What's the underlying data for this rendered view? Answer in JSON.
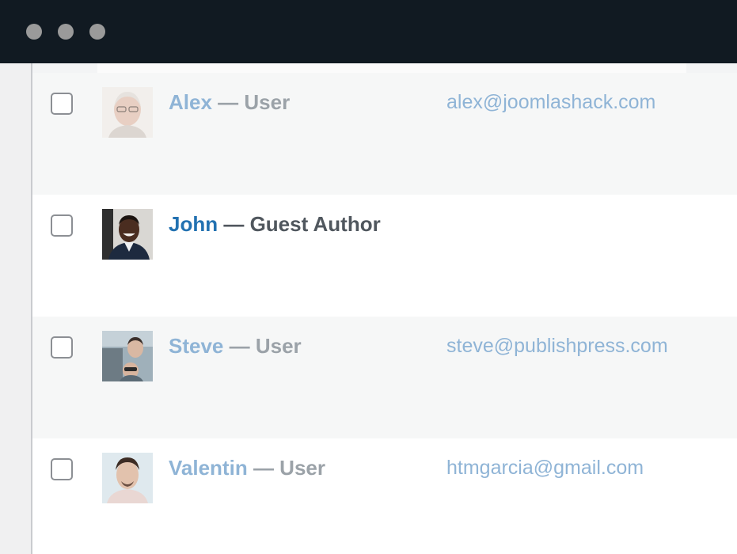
{
  "window": {
    "controls": [
      "close-dot",
      "minimize-dot",
      "maximize-dot"
    ]
  },
  "users": [
    {
      "name": "Alex",
      "role": "— User",
      "email": "alex@joomlashack.com",
      "avatar": "user-avatar-photo"
    },
    {
      "name": "John",
      "role": "— Guest Author",
      "email": "",
      "avatar": "user-avatar-photo"
    },
    {
      "name": "Steve",
      "role": "— User",
      "email": "steve@publishpress.com",
      "avatar": "user-avatar-photo"
    },
    {
      "name": "Valentin",
      "role": "— User",
      "email": "htmgarcia@gmail.com",
      "avatar": "user-avatar-photo"
    }
  ],
  "colors": {
    "titlebar": "#111a22",
    "link": "#2271b1",
    "link_faded": "#8fb4d6",
    "row_alt": "#f6f7f7"
  }
}
